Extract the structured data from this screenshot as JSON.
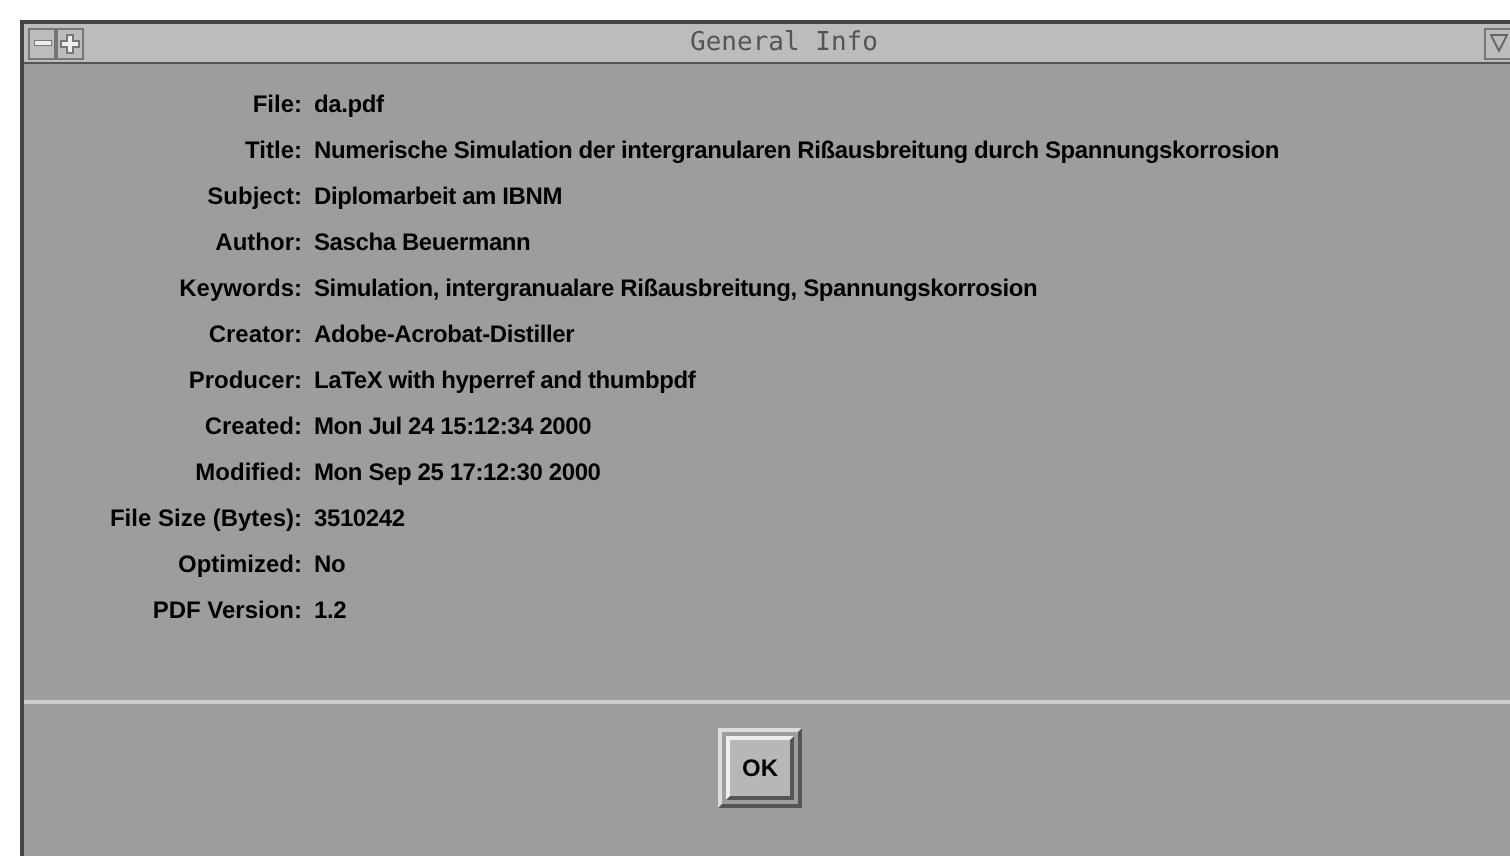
{
  "window": {
    "title": "General Info"
  },
  "fields": [
    {
      "label": "File:",
      "value": "da.pdf"
    },
    {
      "label": "Title:",
      "value": "Numerische Simulation der intergranularen Rißausbreitung durch Spannungskorrosion"
    },
    {
      "label": "Subject:",
      "value": "Diplomarbeit am IBNM"
    },
    {
      "label": "Author:",
      "value": "Sascha Beuermann"
    },
    {
      "label": "Keywords:",
      "value": "Simulation, intergranualare Rißausbreitung, Spannungskorrosion"
    },
    {
      "label": "Creator:",
      "value": "Adobe-Acrobat-Distiller"
    },
    {
      "label": "Producer:",
      "value": "LaTeX with hyperref and thumbpdf"
    },
    {
      "label": "Created:",
      "value": "Mon Jul 24 15:12:34 2000"
    },
    {
      "label": "Modified:",
      "value": "Mon Sep 25 17:12:30 2000"
    },
    {
      "label": "File Size (Bytes):",
      "value": "3510242"
    },
    {
      "label": "Optimized:",
      "value": "No"
    },
    {
      "label": "PDF Version:",
      "value": "1.2"
    }
  ],
  "buttons": [
    {
      "label": "OK"
    }
  ]
}
